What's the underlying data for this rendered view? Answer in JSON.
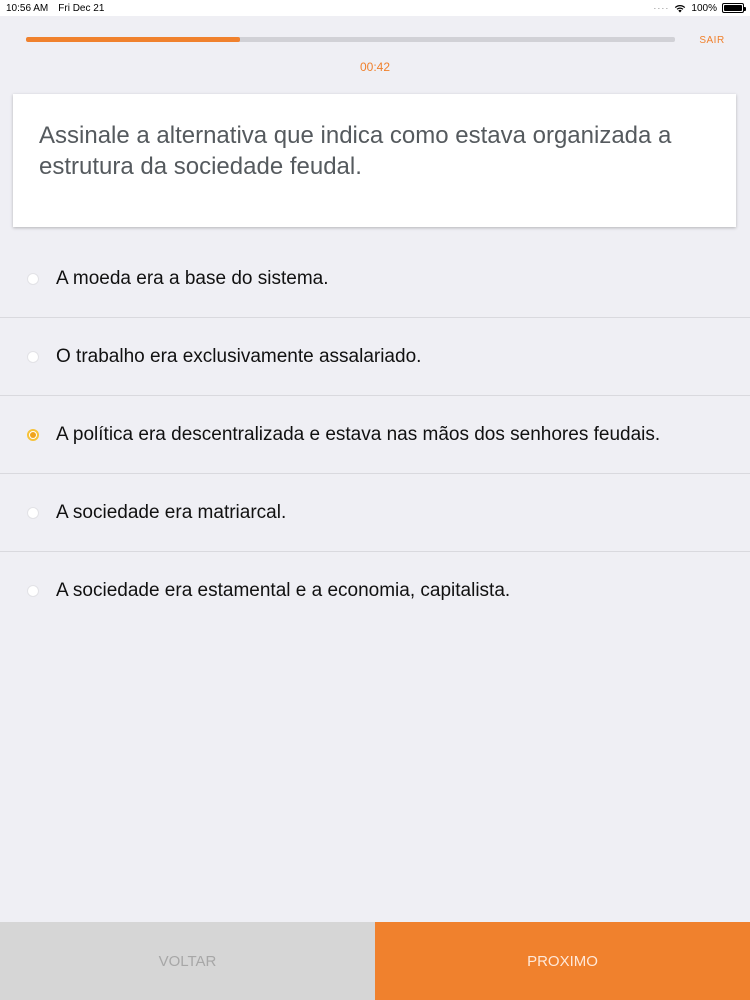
{
  "status_bar": {
    "time": "10:56 AM",
    "date": "Fri Dec 21",
    "battery": "100%",
    "signal_icon": "signal-dots-icon",
    "wifi_icon": "wifi-icon",
    "battery_icon": "battery-icon"
  },
  "quiz": {
    "progress_fraction": 0.33,
    "exit_label": "SAIR",
    "timer": "00:42",
    "question": "Assinale a alternativa que indica como estava organizada a estrutura da sociedade feudal.",
    "options": [
      {
        "label": "A moeda  era a base do sistema.",
        "selected": false
      },
      {
        "label": "O trabalho era exclusivamente assalariado.",
        "selected": false
      },
      {
        "label": "A política era descentralizada e estava nas mãos dos senhores feudais.",
        "selected": true
      },
      {
        "label": "A sociedade era matriarcal.",
        "selected": false
      },
      {
        "label": "A sociedade era estamental e a economia, capitalista.",
        "selected": false
      }
    ]
  },
  "footer": {
    "back_label": "VOLTAR",
    "next_label": "PROXIMO"
  },
  "colors": {
    "accent": "#f0812d",
    "selected_radio": "#f0a41d",
    "background": "#efeff4"
  }
}
